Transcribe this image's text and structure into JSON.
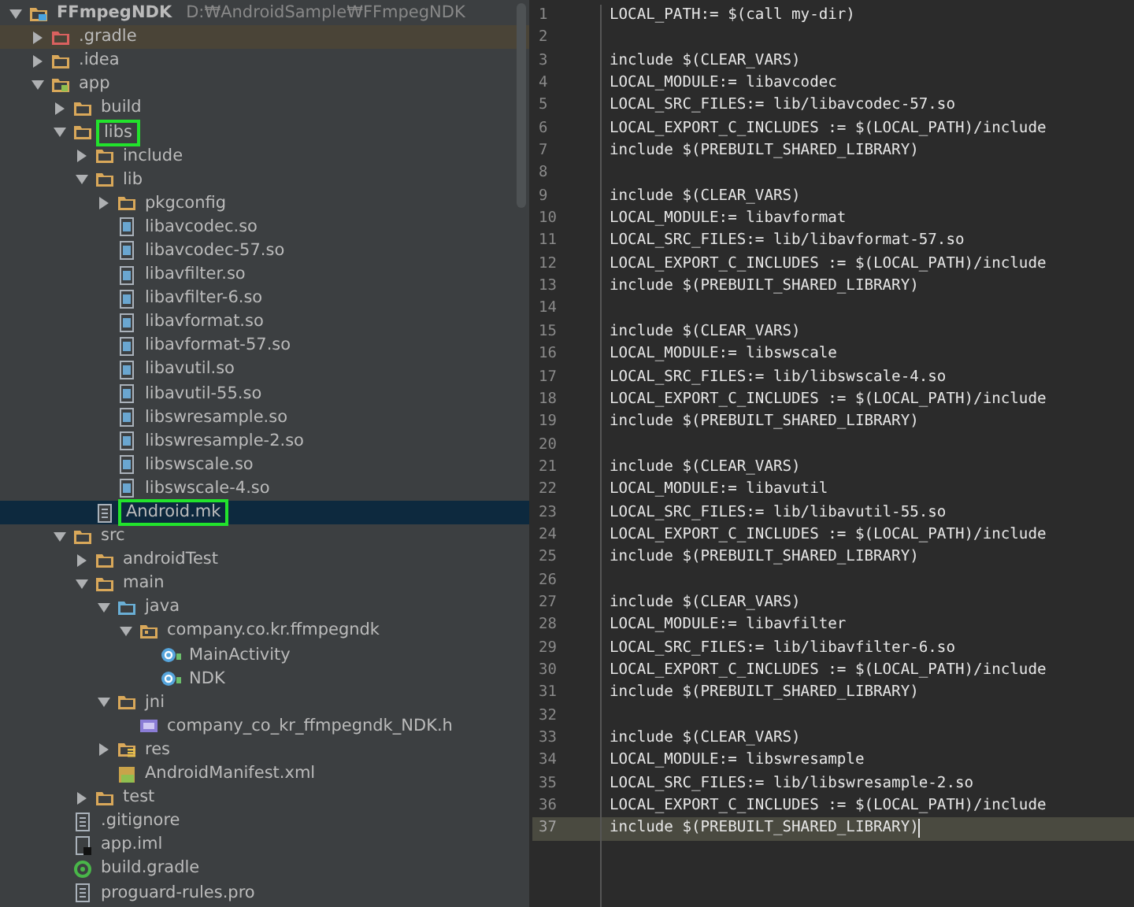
{
  "project_tree": {
    "items": [
      {
        "label": "FFmpegNDK",
        "path": "D:₩AndroidSample₩FFmpegNDK",
        "kind": "project",
        "expanded": true,
        "selected": false,
        "highlighted": false,
        "children": [
          {
            "label": ".gradle",
            "kind": "excluded",
            "expanded": false,
            "selected": false,
            "highlighted": false
          },
          {
            "label": ".idea",
            "kind": "folder",
            "expanded": false,
            "selected": false,
            "highlighted": false
          },
          {
            "label": "app",
            "kind": "module",
            "expanded": true,
            "selected": false,
            "highlighted": false,
            "children": [
              {
                "label": "build",
                "kind": "folder",
                "expanded": false,
                "selected": false,
                "highlighted": false
              },
              {
                "label": "libs",
                "kind": "folder",
                "expanded": true,
                "selected": false,
                "highlighted": true,
                "children": [
                  {
                    "label": "include",
                    "kind": "folder",
                    "expanded": false,
                    "selected": false,
                    "highlighted": false
                  },
                  {
                    "label": "lib",
                    "kind": "folder",
                    "expanded": true,
                    "selected": false,
                    "highlighted": false,
                    "children": [
                      {
                        "label": "pkgconfig",
                        "kind": "folder",
                        "expanded": false,
                        "selected": false,
                        "highlighted": false
                      },
                      {
                        "label": "libavcodec.so",
                        "kind": "unknown",
                        "selected": false,
                        "highlighted": false
                      },
                      {
                        "label": "libavcodec-57.so",
                        "kind": "unknown",
                        "selected": false,
                        "highlighted": false
                      },
                      {
                        "label": "libavfilter.so",
                        "kind": "unknown",
                        "selected": false,
                        "highlighted": false
                      },
                      {
                        "label": "libavfilter-6.so",
                        "kind": "unknown",
                        "selected": false,
                        "highlighted": false
                      },
                      {
                        "label": "libavformat.so",
                        "kind": "unknown",
                        "selected": false,
                        "highlighted": false
                      },
                      {
                        "label": "libavformat-57.so",
                        "kind": "unknown",
                        "selected": false,
                        "highlighted": false
                      },
                      {
                        "label": "libavutil.so",
                        "kind": "unknown",
                        "selected": false,
                        "highlighted": false
                      },
                      {
                        "label": "libavutil-55.so",
                        "kind": "unknown",
                        "selected": false,
                        "highlighted": false
                      },
                      {
                        "label": "libswresample.so",
                        "kind": "unknown",
                        "selected": false,
                        "highlighted": false
                      },
                      {
                        "label": "libswresample-2.so",
                        "kind": "unknown",
                        "selected": false,
                        "highlighted": false
                      },
                      {
                        "label": "libswscale.so",
                        "kind": "unknown",
                        "selected": false,
                        "highlighted": false
                      },
                      {
                        "label": "libswscale-4.so",
                        "kind": "unknown",
                        "selected": false,
                        "highlighted": false
                      }
                    ]
                  },
                  {
                    "label": "Android.mk",
                    "kind": "text",
                    "selected": true,
                    "highlighted": true
                  }
                ]
              },
              {
                "label": "src",
                "kind": "folder",
                "expanded": true,
                "selected": false,
                "highlighted": false,
                "children": [
                  {
                    "label": "androidTest",
                    "kind": "folder",
                    "expanded": false,
                    "selected": false,
                    "highlighted": false
                  },
                  {
                    "label": "main",
                    "kind": "folder",
                    "expanded": true,
                    "selected": false,
                    "highlighted": false,
                    "children": [
                      {
                        "label": "java",
                        "kind": "source",
                        "expanded": true,
                        "selected": false,
                        "highlighted": false,
                        "children": [
                          {
                            "label": "company.co.kr.ffmpegndk",
                            "kind": "package",
                            "expanded": true,
                            "selected": false,
                            "highlighted": false,
                            "children": [
                              {
                                "label": "MainActivity",
                                "kind": "class",
                                "selected": false,
                                "highlighted": false
                              },
                              {
                                "label": "NDK",
                                "kind": "class",
                                "selected": false,
                                "highlighted": false
                              }
                            ]
                          }
                        ]
                      },
                      {
                        "label": "jni",
                        "kind": "folder",
                        "expanded": true,
                        "selected": false,
                        "highlighted": false,
                        "children": [
                          {
                            "label": "company_co_kr_ffmpegndk_NDK.h",
                            "kind": "header",
                            "selected": false,
                            "highlighted": false
                          }
                        ]
                      },
                      {
                        "label": "res",
                        "kind": "resources",
                        "expanded": false,
                        "selected": false,
                        "highlighted": false
                      },
                      {
                        "label": "AndroidManifest.xml",
                        "kind": "manifest",
                        "selected": false,
                        "highlighted": false
                      }
                    ]
                  },
                  {
                    "label": "test",
                    "kind": "folder",
                    "expanded": false,
                    "selected": false,
                    "highlighted": false
                  }
                ]
              },
              {
                "label": ".gitignore",
                "kind": "text",
                "selected": false,
                "highlighted": false
              },
              {
                "label": "app.iml",
                "kind": "iml",
                "selected": false,
                "highlighted": false
              },
              {
                "label": "build.gradle",
                "kind": "gradle",
                "selected": false,
                "highlighted": false
              },
              {
                "label": "proguard-rules.pro",
                "kind": "text",
                "selected": false,
                "highlighted": false
              }
            ]
          }
        ]
      }
    ]
  },
  "editor": {
    "lines": [
      {
        "number": "1",
        "text": "LOCAL_PATH:= $(call my-dir)",
        "current": false
      },
      {
        "number": "2",
        "current": false
      },
      {
        "number": "3",
        "text": "include $(CLEAR_VARS)",
        "current": false
      },
      {
        "number": "4",
        "text": "LOCAL_MODULE:= libavcodec",
        "current": false
      },
      {
        "number": "5",
        "text": "LOCAL_SRC_FILES:= lib/libavcodec-57.so",
        "current": false
      },
      {
        "number": "6",
        "text": "LOCAL_EXPORT_C_INCLUDES := $(LOCAL_PATH)/include",
        "current": false
      },
      {
        "number": "7",
        "text": "include $(PREBUILT_SHARED_LIBRARY)",
        "current": false
      },
      {
        "number": "8",
        "current": false
      },
      {
        "number": "9",
        "text": "include $(CLEAR_VARS)",
        "current": false
      },
      {
        "number": "10",
        "text": "LOCAL_MODULE:= libavformat",
        "current": false
      },
      {
        "number": "11",
        "text": "LOCAL_SRC_FILES:= lib/libavformat-57.so",
        "current": false
      },
      {
        "number": "12",
        "text": "LOCAL_EXPORT_C_INCLUDES := $(LOCAL_PATH)/include",
        "current": false
      },
      {
        "number": "13",
        "text": "include $(PREBUILT_SHARED_LIBRARY)",
        "current": false
      },
      {
        "number": "14",
        "current": false
      },
      {
        "number": "15",
        "text": "include $(CLEAR_VARS)",
        "current": false
      },
      {
        "number": "16",
        "text": "LOCAL_MODULE:= libswscale",
        "current": false
      },
      {
        "number": "17",
        "text": "LOCAL_SRC_FILES:= lib/libswscale-4.so",
        "current": false
      },
      {
        "number": "18",
        "text": "LOCAL_EXPORT_C_INCLUDES := $(LOCAL_PATH)/include",
        "current": false
      },
      {
        "number": "19",
        "text": "include $(PREBUILT_SHARED_LIBRARY)",
        "current": false
      },
      {
        "number": "20",
        "current": false
      },
      {
        "number": "21",
        "text": "include $(CLEAR_VARS)",
        "current": false
      },
      {
        "number": "22",
        "text": "LOCAL_MODULE:= libavutil",
        "current": false
      },
      {
        "number": "23",
        "text": "LOCAL_SRC_FILES:= lib/libavutil-55.so",
        "current": false
      },
      {
        "number": "24",
        "text": "LOCAL_EXPORT_C_INCLUDES := $(LOCAL_PATH)/include",
        "current": false
      },
      {
        "number": "25",
        "text": "include $(PREBUILT_SHARED_LIBRARY)",
        "current": false
      },
      {
        "number": "26",
        "current": false
      },
      {
        "number": "27",
        "text": "include $(CLEAR_VARS)",
        "current": false
      },
      {
        "number": "28",
        "text": "LOCAL_MODULE:= libavfilter",
        "current": false
      },
      {
        "number": "29",
        "text": "LOCAL_SRC_FILES:= lib/libavfilter-6.so",
        "current": false
      },
      {
        "number": "30",
        "text": "LOCAL_EXPORT_C_INCLUDES := $(LOCAL_PATH)/include",
        "current": false
      },
      {
        "number": "31",
        "text": "include $(PREBUILT_SHARED_LIBRARY)",
        "current": false
      },
      {
        "number": "32",
        "current": false
      },
      {
        "number": "33",
        "text": "include $(CLEAR_VARS)",
        "current": false
      },
      {
        "number": "34",
        "text": "LOCAL_MODULE:= libswresample",
        "current": false
      },
      {
        "number": "35",
        "text": "LOCAL_SRC_FILES:= lib/libswresample-2.so",
        "current": false
      },
      {
        "number": "36",
        "text": "LOCAL_EXPORT_C_INCLUDES := $(LOCAL_PATH)/include",
        "current": false
      },
      {
        "number": "37",
        "text": "include $(PREBUILT_SHARED_LIBRARY)",
        "current": true
      }
    ]
  }
}
